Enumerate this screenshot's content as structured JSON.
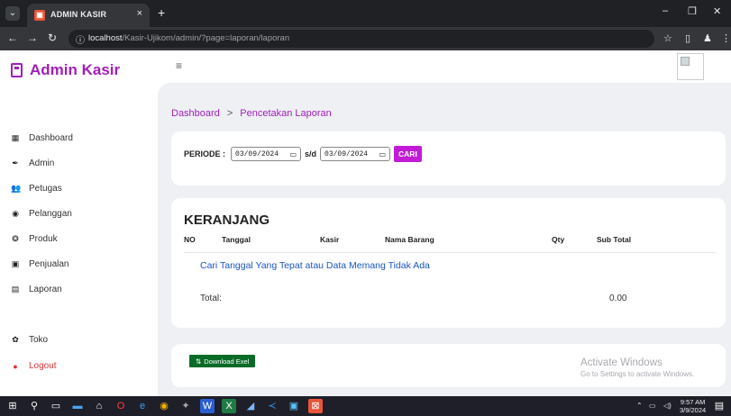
{
  "browser": {
    "tab_title": "ADMIN KASIR",
    "tab_close": "×",
    "new_tab": "+",
    "url_host": "localhost",
    "url_path": "/Kasir-Ujikom/admin/?page=laporan/laporan",
    "minimize": "–",
    "maximize": "❐",
    "close": "✕"
  },
  "brand": {
    "title": "Admin Kasir"
  },
  "topbar": {
    "menu_glyph": "≡"
  },
  "sidebar": {
    "items": [
      {
        "label": "Dashboard",
        "icon": "dashboard-icon",
        "glyph": "▦"
      },
      {
        "label": "Admin",
        "icon": "admin-icon",
        "glyph": "✒"
      },
      {
        "label": "Petugas",
        "icon": "users-icon",
        "glyph": "👥"
      },
      {
        "label": "Pelanggan",
        "icon": "customer-icon",
        "glyph": "◉"
      },
      {
        "label": "Produk",
        "icon": "product-icon",
        "glyph": "❂"
      },
      {
        "label": "Penjualan",
        "icon": "sales-icon",
        "glyph": "▣"
      },
      {
        "label": "Laporan",
        "icon": "report-icon",
        "glyph": "▤"
      },
      {
        "label": "Toko",
        "icon": "store-icon",
        "glyph": "✿"
      },
      {
        "label": "Logout",
        "icon": "logout-icon",
        "glyph": "●"
      }
    ]
  },
  "breadcrumb": {
    "home": "Dashboard",
    "separator": ">",
    "current": "Pencetakan Laporan"
  },
  "periode": {
    "label": "PERIODE :",
    "from": "03/09/2024",
    "separator": "s/d",
    "to": "03/09/2024",
    "search_button": "CARI"
  },
  "keranjang": {
    "title": "KERANJANG",
    "columns": [
      "NO",
      "Tanggal",
      "Kasir",
      "Nama Barang",
      "Qty",
      "Sub Total"
    ],
    "empty_message": "Cari Tanggal Yang Tepat atau Data Memang Tidak Ada",
    "total_label": "Total:",
    "total_value": "0.00"
  },
  "download": {
    "label": "Download Exel",
    "glyph": "⇅"
  },
  "watermark": {
    "line1": "Activate Windows",
    "line2": "Go to Settings to activate Windows."
  },
  "taskbar": {
    "time": "9:57 AM",
    "date": "3/9/2024"
  },
  "colors": {
    "accent": "#a01fb8",
    "button": "#c21bd6",
    "download": "#0a6b27",
    "link": "#1a55c5"
  }
}
